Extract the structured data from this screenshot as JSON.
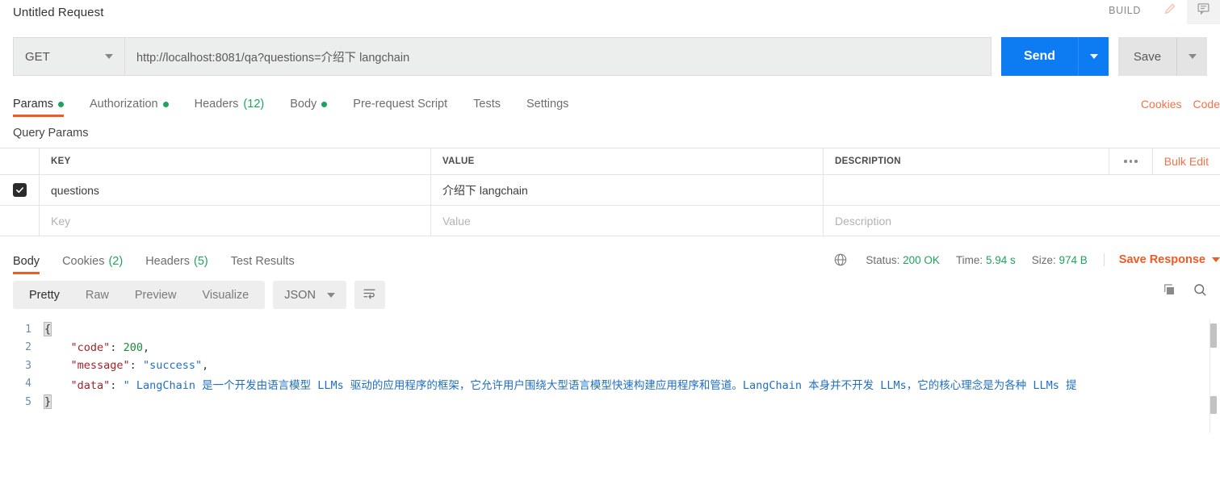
{
  "header": {
    "request_title": "Untitled Request",
    "build_label": "BUILD",
    "edit_icon": "pencil-icon",
    "comment_icon": "comment-icon"
  },
  "url_bar": {
    "method": "GET",
    "url": "http://localhost:8081/qa?questions=介绍下 langchain",
    "send_label": "Send",
    "save_label": "Save"
  },
  "request_tabs": [
    {
      "label": "Params",
      "indicator": "dot",
      "active": true
    },
    {
      "label": "Authorization",
      "indicator": "dot",
      "active": false
    },
    {
      "label": "Headers",
      "count": "(12)",
      "active": false
    },
    {
      "label": "Body",
      "indicator": "dot",
      "active": false
    },
    {
      "label": "Pre-request Script",
      "active": false
    },
    {
      "label": "Tests",
      "active": false
    },
    {
      "label": "Settings",
      "active": false
    }
  ],
  "tabs_right": {
    "cookies": "Cookies",
    "code": "Code"
  },
  "query_params": {
    "section_label": "Query Params",
    "columns": [
      "KEY",
      "VALUE",
      "DESCRIPTION"
    ],
    "bulk_edit_label": "Bulk Edit",
    "rows": [
      {
        "checked": true,
        "key": "questions",
        "value": "介绍下 langchain",
        "description": ""
      }
    ],
    "placeholder_row": {
      "key": "Key",
      "value": "Value",
      "description": "Description"
    }
  },
  "response_tabs": [
    {
      "label": "Body",
      "active": true
    },
    {
      "label": "Cookies",
      "count": "(2)",
      "active": false
    },
    {
      "label": "Headers",
      "count": "(5)",
      "active": false
    },
    {
      "label": "Test Results",
      "active": false
    }
  ],
  "response_status": {
    "globe_icon": "globe-icon",
    "status_label": "Status:",
    "status_value": "200 OK",
    "time_label": "Time:",
    "time_value": "5.94 s",
    "size_label": "Size:",
    "size_value": "974 B",
    "save_response_label": "Save Response"
  },
  "view_toolbar": {
    "segments": [
      "Pretty",
      "Raw",
      "Preview",
      "Visualize"
    ],
    "active_segment": "Pretty",
    "language": "JSON",
    "wrap_icon": "word-wrap-icon",
    "copy_icon": "copy-icon",
    "search_icon": "search-icon"
  },
  "response_body": {
    "lines": [
      {
        "no": "1",
        "segments": [
          {
            "t": "{",
            "c": "brace"
          }
        ]
      },
      {
        "no": "2",
        "segments": [
          {
            "t": "    ",
            "c": "punc"
          },
          {
            "t": "\"code\"",
            "c": "key"
          },
          {
            "t": ": ",
            "c": "punc"
          },
          {
            "t": "200",
            "c": "num"
          },
          {
            "t": ",",
            "c": "punc"
          }
        ]
      },
      {
        "no": "3",
        "segments": [
          {
            "t": "    ",
            "c": "punc"
          },
          {
            "t": "\"message\"",
            "c": "key"
          },
          {
            "t": ": ",
            "c": "punc"
          },
          {
            "t": "\"success\"",
            "c": "str"
          },
          {
            "t": ",",
            "c": "punc"
          }
        ]
      },
      {
        "no": "4",
        "segments": [
          {
            "t": "    ",
            "c": "punc"
          },
          {
            "t": "\"data\"",
            "c": "key"
          },
          {
            "t": ": ",
            "c": "punc"
          },
          {
            "t": "\" LangChain 是一个开发由语言模型 LLMs 驱动的应用程序的框架，它允许用户围绕大型语言模型快速构建应用程序和管道。LangChain 本身并不开发 LLMs，它的核心理念是为各种 LLMs 提",
            "c": "str"
          }
        ]
      },
      {
        "no": "5",
        "segments": [
          {
            "t": "}",
            "c": "brace"
          }
        ]
      }
    ]
  },
  "colors": {
    "accent_orange": "#ef5b25",
    "send_blue": "#0d7bf2",
    "status_green": "#1ca45c",
    "json_key": "#a3232a",
    "json_string": "#1f6fc4",
    "json_number": "#1a8a3c"
  }
}
